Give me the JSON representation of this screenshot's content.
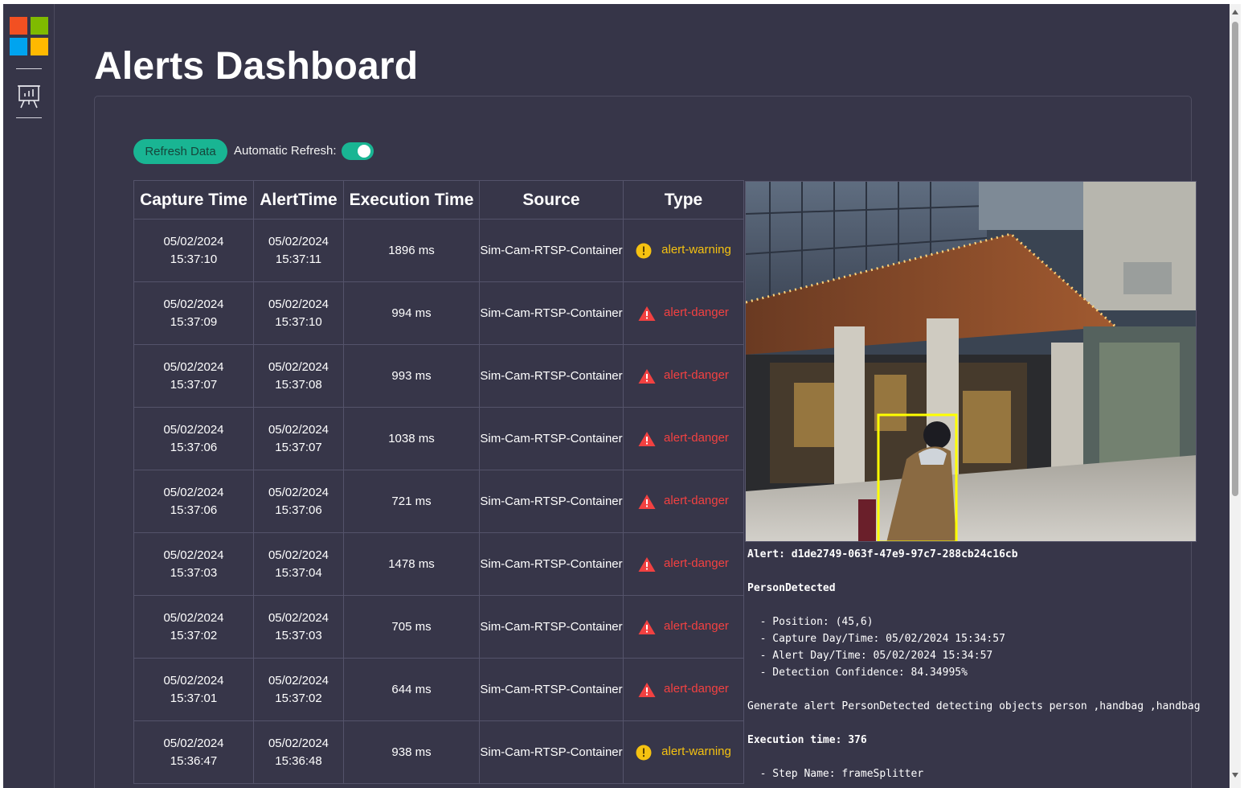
{
  "page": {
    "title": "Alerts Dashboard"
  },
  "toolbar": {
    "refresh_label": "Refresh Data",
    "auto_refresh_label": "Automatic Refresh:",
    "auto_refresh_on": true
  },
  "sidebar": {
    "nav_icon": "presentation-chart-icon"
  },
  "colors": {
    "accent": "#19b593",
    "background": "#363548",
    "warning": "#f5c211",
    "danger": "#f24141",
    "detection_box": "#ffff00"
  },
  "table": {
    "headers": [
      "Capture Time",
      "AlertTime",
      "Execution Time",
      "Source",
      "Type"
    ],
    "rows": [
      {
        "capture_date": "05/02/2024",
        "capture_time": "15:37:10",
        "alert_date": "05/02/2024",
        "alert_time": "15:37:11",
        "execution": "1896 ms",
        "source": "Sim-Cam-RTSP-Container",
        "type": "alert-warning"
      },
      {
        "capture_date": "05/02/2024",
        "capture_time": "15:37:09",
        "alert_date": "05/02/2024",
        "alert_time": "15:37:10",
        "execution": "994 ms",
        "source": "Sim-Cam-RTSP-Container",
        "type": "alert-danger"
      },
      {
        "capture_date": "05/02/2024",
        "capture_time": "15:37:07",
        "alert_date": "05/02/2024",
        "alert_time": "15:37:08",
        "execution": "993 ms",
        "source": "Sim-Cam-RTSP-Container",
        "type": "alert-danger"
      },
      {
        "capture_date": "05/02/2024",
        "capture_time": "15:37:06",
        "alert_date": "05/02/2024",
        "alert_time": "15:37:07",
        "execution": "1038 ms",
        "source": "Sim-Cam-RTSP-Container",
        "type": "alert-danger"
      },
      {
        "capture_date": "05/02/2024",
        "capture_time": "15:37:06",
        "alert_date": "05/02/2024",
        "alert_time": "15:37:06",
        "execution": "721 ms",
        "source": "Sim-Cam-RTSP-Container",
        "type": "alert-danger"
      },
      {
        "capture_date": "05/02/2024",
        "capture_time": "15:37:03",
        "alert_date": "05/02/2024",
        "alert_time": "15:37:04",
        "execution": "1478 ms",
        "source": "Sim-Cam-RTSP-Container",
        "type": "alert-danger"
      },
      {
        "capture_date": "05/02/2024",
        "capture_time": "15:37:02",
        "alert_date": "05/02/2024",
        "alert_time": "15:37:03",
        "execution": "705 ms",
        "source": "Sim-Cam-RTSP-Container",
        "type": "alert-danger"
      },
      {
        "capture_date": "05/02/2024",
        "capture_time": "15:37:01",
        "alert_date": "05/02/2024",
        "alert_time": "15:37:02",
        "execution": "644 ms",
        "source": "Sim-Cam-RTSP-Container",
        "type": "alert-danger"
      },
      {
        "capture_date": "05/02/2024",
        "capture_time": "15:36:47",
        "alert_date": "05/02/2024",
        "alert_time": "15:36:48",
        "execution": "938 ms",
        "source": "Sim-Cam-RTSP-Container",
        "type": "alert-warning"
      }
    ]
  },
  "details": {
    "alert_line": "Alert: d1de2749-063f-47e9-97c7-288cb24c16cb",
    "event": "PersonDetected",
    "position": "  - Position: (45,6)",
    "capture_dt": "  - Capture Day/Time: 05/02/2024 15:34:57",
    "alert_dt": "  - Alert Day/Time: 05/02/2024 15:34:57",
    "confidence": "  - Detection Confidence: 84.34995%",
    "message": "Generate alert PersonDetected detecting objects person ,handbag ,handbag",
    "execution_time": "Execution time: 376",
    "step": "  - Step Name: frameSplitter"
  }
}
